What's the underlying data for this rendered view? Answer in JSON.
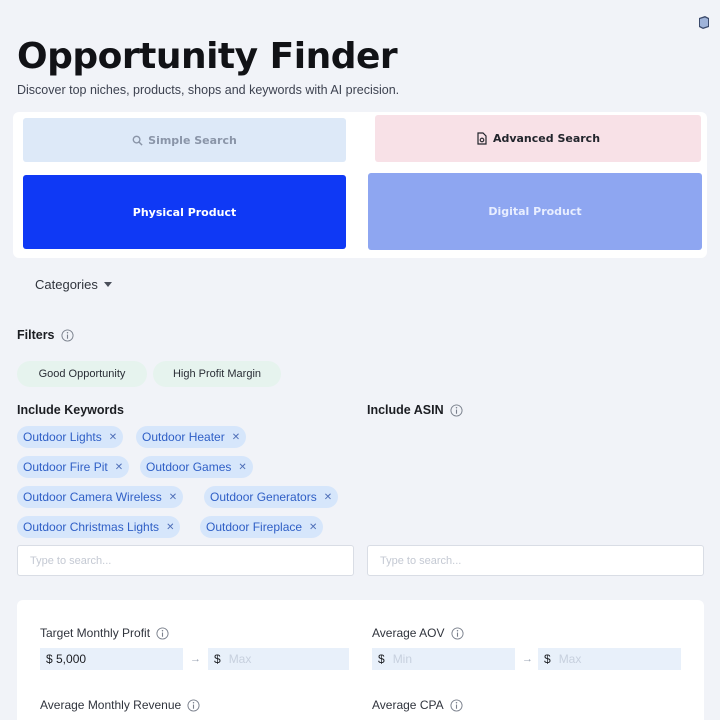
{
  "header": {
    "title": "Opportunity Finder",
    "subtitle": "Discover top niches, products, shops and keywords with AI precision."
  },
  "icons": {
    "top_right": "book-icon",
    "search": "search-icon",
    "advanced": "document-settings-icon",
    "info": "info-icon",
    "caret": "chevron-down-icon",
    "remove": "close-icon"
  },
  "colors": {
    "primary": "#0f39f5",
    "digital": "#8ea6f1",
    "simple_bg": "#dde9f8",
    "advanced_bg": "#f8e1e7",
    "chip_green": "#e6f3ee",
    "chip_blue": "#d6e6fb"
  },
  "search_mode": {
    "simple": "Simple Search",
    "advanced": "Advanced Search",
    "selected": "Advanced Search"
  },
  "product_type": {
    "physical": "Physical Product",
    "digital": "Digital Product",
    "selected": "Physical Product"
  },
  "categories": {
    "label": "Categories"
  },
  "filters": {
    "label": "Filters",
    "chips": [
      "Good Opportunity",
      "High Profit Margin"
    ]
  },
  "include_keywords": {
    "label": "Include Keywords",
    "chips": [
      "Outdoor Lights",
      "Outdoor Heater",
      "Outdoor Fire Pit",
      "Outdoor Games",
      "Outdoor Camera Wireless",
      "Outdoor Generators",
      "Outdoor Christmas Lights",
      "Outdoor Fireplace"
    ],
    "placeholder": "Type to search..."
  },
  "include_asin": {
    "label": "Include ASIN",
    "placeholder": "Type to search..."
  },
  "metrics": {
    "target_monthly_profit": {
      "label": "Target Monthly Profit",
      "min_value": "$ 5,000",
      "max_prefix": "$",
      "max_placeholder": "Max"
    },
    "average_aov": {
      "label": "Average AOV",
      "min_prefix": "$",
      "min_placeholder": "Min",
      "max_prefix": "$",
      "max_placeholder": "Max"
    },
    "average_monthly_revenue": {
      "label": "Average Monthly Revenue"
    },
    "average_cpa": {
      "label": "Average CPA"
    }
  }
}
